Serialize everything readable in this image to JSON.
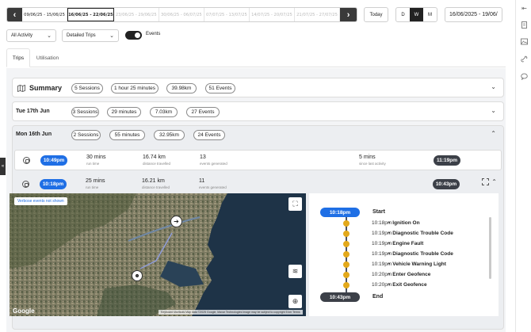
{
  "weekbar": {
    "prev_icon": "chevron-left-icon",
    "next_icon": "chevron-right-icon",
    "weeks": [
      "09/06/25 - 15/06/25",
      "16/06/25 - 22/06/25",
      "23/06/25 - 29/06/25",
      "30/06/25 - 06/07/25",
      "07/07/25 - 13/07/25",
      "14/07/25 - 20/07/25",
      "21/07/25 - 27/07/25"
    ],
    "selected_index": 1
  },
  "today_label": "Today",
  "dwm": {
    "d": "D",
    "w": "W",
    "m": "M",
    "selected": "W"
  },
  "daterange": "16/06/2025 - 19/06/",
  "filters": {
    "activity": "All Activity",
    "view": "Detailed Trips",
    "events_label": "Events",
    "events_on": true
  },
  "tabs": [
    "Trips",
    "Utilisation"
  ],
  "summary": {
    "title": "Summary",
    "pills": [
      "5 Sessions",
      "1 hour 25 minutes",
      "39.98km",
      "51 Events"
    ]
  },
  "tue": {
    "title": "Tue 17th Jun",
    "pills": [
      "3 Sessions",
      "29 minutes",
      "7.03km",
      "27 Events"
    ]
  },
  "mon": {
    "title": "Mon 16th Jun",
    "pills": [
      "2 Sessions",
      "55 minutes",
      "32.95km",
      "24 Events"
    ]
  },
  "trip1": {
    "start": "10:49pm",
    "end": "11:19pm",
    "run_val": "30 mins",
    "run_lbl": "run time",
    "dist_val": "16.74 km",
    "dist_lbl": "distance travelled",
    "ev_val": "13",
    "ev_lbl": "events generated",
    "since_val": "5 mins",
    "since_lbl": "since last activity"
  },
  "trip2": {
    "start": "10:18pm",
    "end": "10:43pm",
    "run_val": "25 mins",
    "run_lbl": "run time",
    "dist_val": "16.21 km",
    "dist_lbl": "distance travelled",
    "ev_val": "11",
    "ev_lbl": "events generated"
  },
  "map": {
    "tag": "Verbose events not shown",
    "logo": "Google",
    "footer": "Keyboard shortcuts   Map data ©2025 Google, Maxar Technologies   Image may be subject to copyright   5 km   Terms"
  },
  "timeline": {
    "start_time": "10:18pm",
    "start_label": "Start",
    "end_time": "10:43pm",
    "end_label": "End",
    "events": [
      {
        "time": "10:18pm",
        "text": "Ignition On"
      },
      {
        "time": "10:19pm",
        "text": "Diagnostic Trouble Code"
      },
      {
        "time": "10:19pm",
        "text": "Engine Fault"
      },
      {
        "time": "10:19pm",
        "text": "Diagnostic Trouble Code"
      },
      {
        "time": "10:19pm",
        "text": "Vehicle Warning Light"
      },
      {
        "time": "10:20pm",
        "text": "Enter Geofence"
      },
      {
        "time": "10:20pm",
        "text": "Exit Geofence"
      }
    ]
  },
  "colors": {
    "accent_blue": "#1f6fe5",
    "event_dot": "#e3a91b",
    "dark_badge": "#3c4048"
  }
}
